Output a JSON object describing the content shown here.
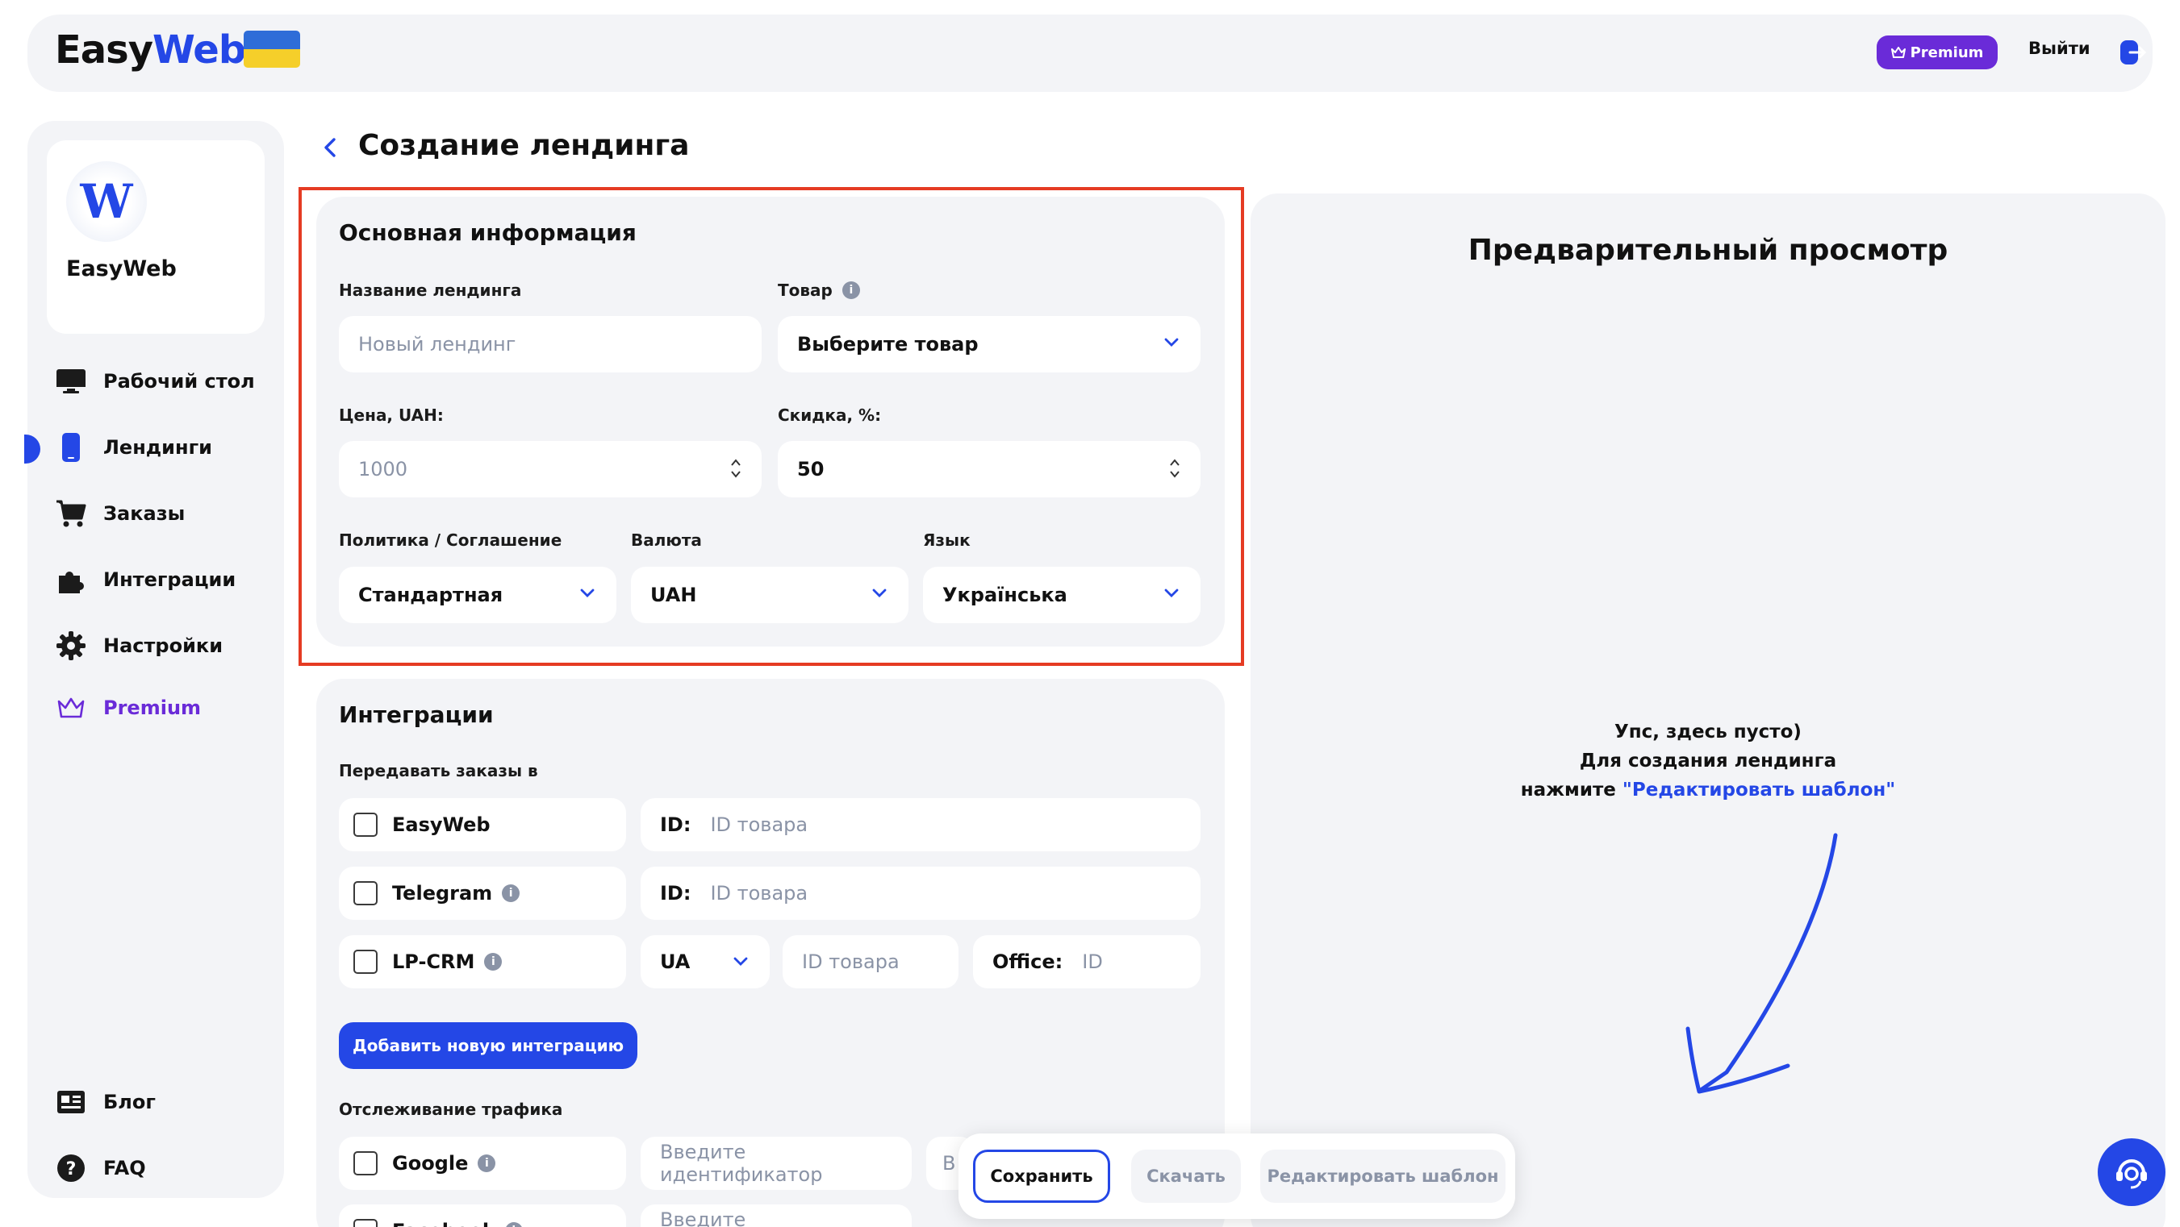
{
  "header": {
    "logo_easy": "Easy",
    "logo_web": "Web",
    "premium": "Premium",
    "logout": "Выйти"
  },
  "sidebar": {
    "brand_initial": "W",
    "brand_name": "EasyWeb",
    "items": [
      {
        "label": "Рабочий стол",
        "icon": "desktop-icon"
      },
      {
        "label": "Лендинги",
        "icon": "phone-icon",
        "active": true
      },
      {
        "label": "Заказы",
        "icon": "cart-icon"
      },
      {
        "label": "Интеграции",
        "icon": "puzzle-icon"
      },
      {
        "label": "Настройки",
        "icon": "gear-icon"
      },
      {
        "label": "Premium",
        "icon": "crown-icon"
      }
    ],
    "bottom_items": [
      {
        "label": "Блог",
        "icon": "newspaper-icon"
      },
      {
        "label": "FAQ",
        "icon": "question-icon"
      }
    ]
  },
  "page": {
    "title": "Создание лендинга"
  },
  "basic": {
    "title": "Основная информация",
    "name_label": "Название лендинга",
    "name_placeholder": "Новый лендинг",
    "product_label": "Товар",
    "product_value": "Выберите товар",
    "price_label_prefix": "Цена, ",
    "price_label_unit": "UAH",
    "price_label_suffix": ":",
    "price_placeholder": "1000",
    "discount_label": "Скидка, %:",
    "discount_value": "50",
    "policy_label": "Политика / Соглашение",
    "policy_value": "Стандартная",
    "currency_label": "Валюта",
    "currency_value": "UAH",
    "language_label": "Язык",
    "language_value": "Українська"
  },
  "integrations": {
    "title": "Интеграции",
    "send_label": "Передавать заказы в",
    "id_key": "ID:",
    "id_placeholder": "ID товара",
    "rows": [
      {
        "name": "EasyWeb"
      },
      {
        "name": "Telegram"
      },
      {
        "name": "LP-CRM"
      }
    ],
    "lpcrm_region": "UA",
    "office_key": "Office:",
    "office_placeholder": "ID",
    "add_button": "Добавить новую интеграцию",
    "tracking_label": "Отслеживание трафика",
    "tracking": [
      {
        "name": "Google",
        "placeholder": "Введите идентификатор"
      },
      {
        "name": "Facebook",
        "placeholder": "Введите идентификатор"
      }
    ],
    "partial_char": "В"
  },
  "preview": {
    "title": "Предварительный просмотр",
    "empty_line1": "Упс, здесь пусто)",
    "empty_line2": "Для создания лендинга",
    "empty_line3_prefix": "нажмите ",
    "empty_line3_link": "\"Редактировать шаблон\""
  },
  "actions": {
    "save": "Сохранить",
    "download": "Скачать",
    "edit_template": "Редактировать шаблон"
  },
  "colors": {
    "accent": "#2447e6",
    "premium": "#6a2bd8",
    "highlight": "#e53b23",
    "panel": "#f3f4f7"
  }
}
